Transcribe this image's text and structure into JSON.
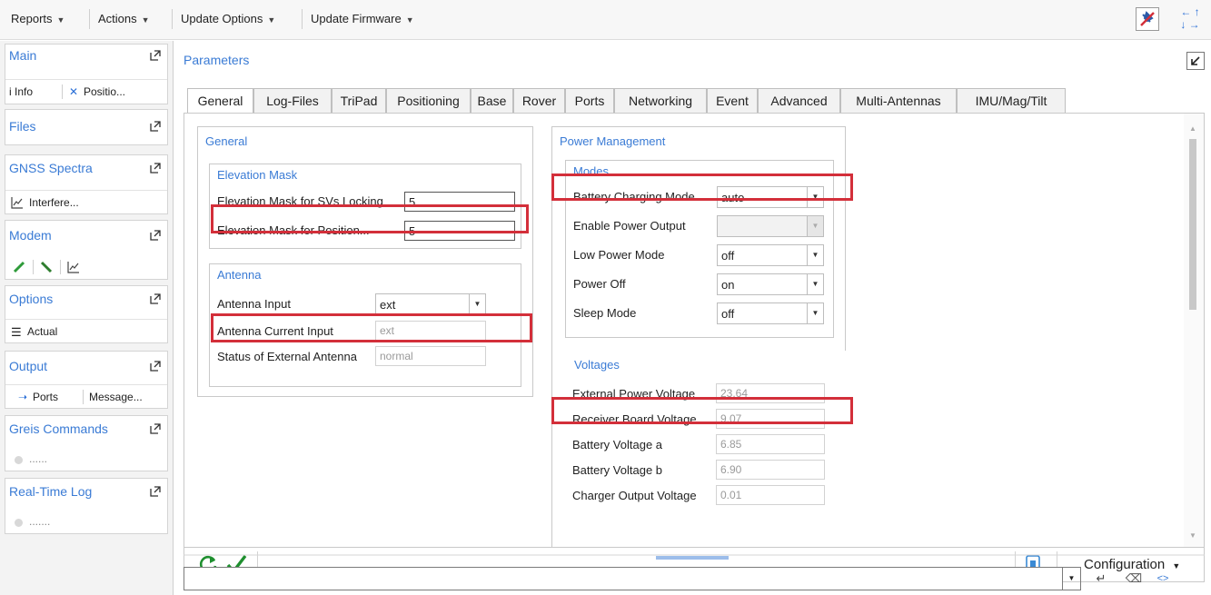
{
  "menubar": {
    "items": [
      {
        "label": "Reports"
      },
      {
        "label": "Actions"
      },
      {
        "label": "Update Options"
      },
      {
        "label": "Update Firmware"
      }
    ],
    "dropdown_glyph": "▼",
    "arrows": {
      "left": "←",
      "up": "↑",
      "down": "↓",
      "right": "→"
    }
  },
  "sidebar": {
    "sections": [
      {
        "title": "Main",
        "items": [
          {
            "icon": "info-icon",
            "label": "i Info"
          },
          {
            "icon": "satellite-icon",
            "label": "Positio..."
          }
        ]
      },
      {
        "title": "Files",
        "items": []
      },
      {
        "title": "GNSS Spectra",
        "items": [
          {
            "icon": "chart-icon",
            "label": "Interfere..."
          }
        ]
      },
      {
        "title": "Modem",
        "items": [
          {
            "icon": "link-green-icon",
            "label": ""
          },
          {
            "icon": "link-green-dark-icon",
            "label": ""
          },
          {
            "icon": "chart-icon",
            "label": ""
          }
        ]
      },
      {
        "title": "Options",
        "items": [
          {
            "icon": "list-icon",
            "label": "Actual"
          }
        ]
      },
      {
        "title": "Output",
        "items": [
          {
            "icon": "arrow-right-icon",
            "label": "Ports"
          },
          {
            "icon": "",
            "label": "Message..."
          }
        ]
      },
      {
        "title": "Greis Commands",
        "items": [
          {
            "icon": "dot-icon",
            "label": "......"
          }
        ]
      },
      {
        "title": "Real-Time Log",
        "items": [
          {
            "icon": "dot-icon",
            "label": "......."
          }
        ]
      }
    ]
  },
  "main": {
    "title": "Parameters",
    "tabs": [
      {
        "label": "General",
        "active": true
      },
      {
        "label": "Log-Files"
      },
      {
        "label": "TriPad"
      },
      {
        "label": "Positioning"
      },
      {
        "label": "Base"
      },
      {
        "label": "Rover"
      },
      {
        "label": "Ports"
      },
      {
        "label": "Networking"
      },
      {
        "label": "Event"
      },
      {
        "label": "Advanced"
      },
      {
        "label": "Multi-Antennas"
      },
      {
        "label": "IMU/Mag/Tilt"
      }
    ]
  },
  "general": {
    "title": "General",
    "elevation": {
      "title": "Elevation Mask",
      "svs_label": "Elevation Mask for SVs Locking",
      "svs_value": "5",
      "pos_label": "Elevation Mask for Position...",
      "pos_value": "5"
    },
    "antenna": {
      "title": "Antenna",
      "input_label": "Antenna Input",
      "input_value": "ext",
      "current_label": "Antenna Current Input",
      "current_value": "ext",
      "status_label": "Status of External Antenna",
      "status_value": "normal"
    }
  },
  "power": {
    "title": "Power Management",
    "modes": {
      "title": "Modes",
      "rows": [
        {
          "label": "Battery Charging Mode",
          "value": "auto",
          "disabled": false
        },
        {
          "label": "Enable Power Output",
          "value": "",
          "disabled": true
        },
        {
          "label": "Low Power Mode",
          "value": "off",
          "disabled": false
        },
        {
          "label": "Power Off",
          "value": "on",
          "disabled": false
        },
        {
          "label": "Sleep Mode",
          "value": "off",
          "disabled": false
        }
      ]
    },
    "voltages": {
      "title": "Voltages",
      "rows": [
        {
          "label": "External Power Voltage",
          "value": "23.64"
        },
        {
          "label": "Receiver Board Voltage",
          "value": "9.07"
        },
        {
          "label": "Battery Voltage a",
          "value": "6.85"
        },
        {
          "label": "Battery Voltage b",
          "value": "6.90"
        },
        {
          "label": "Charger Output Voltage",
          "value": "0.01"
        }
      ]
    }
  },
  "bottombar": {
    "config_label": "Configuration",
    "config_glyph": "▼"
  },
  "cmdline": {
    "value": "",
    "enter_glyph": "↵",
    "eraser_glyph": "⌫",
    "code_glyph": "<>"
  },
  "colors": {
    "accent": "#3a7bd5",
    "highlight": "#d32f3a",
    "check": "#1f8f2f"
  }
}
